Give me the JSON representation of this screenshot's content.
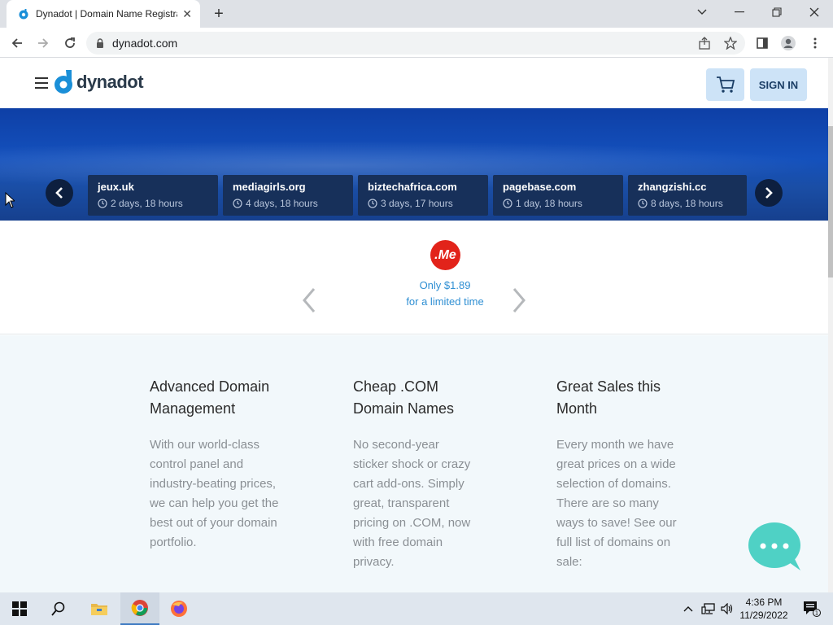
{
  "browser": {
    "tab_title": "Dynadot | Domain Name Registrar",
    "url": "dynadot.com"
  },
  "header": {
    "logo_text": "dynadot",
    "signin_label": "SIGN IN"
  },
  "auctions": [
    {
      "domain": "jeux.uk",
      "time": "2 days, 18 hours"
    },
    {
      "domain": "mediagirls.org",
      "time": "4 days, 18 hours"
    },
    {
      "domain": "biztechafrica.com",
      "time": "3 days, 17 hours"
    },
    {
      "domain": "pagebase.com",
      "time": "1 day, 18 hours"
    },
    {
      "domain": "zhangzishi.cc",
      "time": "8 days, 18 hours"
    }
  ],
  "promo": {
    "logo_text": ".Me",
    "line1": "Only $1.89",
    "line2": "for a limited time"
  },
  "features": [
    {
      "title": "Advanced Domain Management",
      "body": "With our world-class control panel and industry-beating prices, we can help you get the best out of your domain portfolio."
    },
    {
      "title": "Cheap .COM Domain Names",
      "body": "No second-year sticker shock or crazy cart add-ons. Simply great, transparent pricing on .COM, now with free domain privacy."
    },
    {
      "title": "Great Sales this Month",
      "body": "Every month we have great prices on a wide selection of domains. There are so many ways to save! See our full list of domains on sale:"
    }
  ],
  "taskbar": {
    "time": "4:36 PM",
    "date": "11/29/2022",
    "notification_count": "1"
  },
  "colors": {
    "hero_blue": "#1451bd",
    "accent_blue": "#2f8fd3",
    "button_bg": "#cde3f7",
    "promo_red": "#e2231a",
    "chat_teal": "#4fd1c5"
  }
}
